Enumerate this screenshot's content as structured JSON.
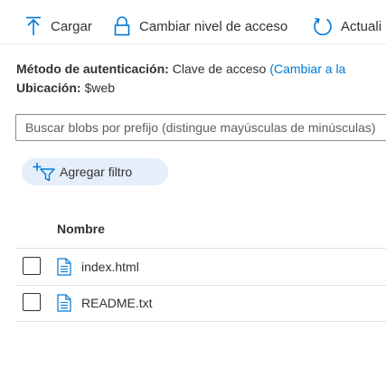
{
  "toolbar": {
    "upload_label": "Cargar",
    "change_access_label": "Cambiar nivel de acceso",
    "refresh_label": "Actuali"
  },
  "info": {
    "auth_method_label": "Método de autenticación:",
    "auth_method_value": "Clave de acceso",
    "auth_method_link": "(Cambiar a la",
    "location_label": "Ubicación:",
    "location_value": "$web"
  },
  "search": {
    "placeholder": "Buscar blobs por prefijo (distingue mayúsculas de minúsculas)"
  },
  "filter": {
    "add_filter_label": "Agregar filtro"
  },
  "table": {
    "columns": [
      "Nombre"
    ],
    "rows": [
      {
        "name": "index.html"
      },
      {
        "name": "README.txt"
      }
    ]
  },
  "colors": {
    "accent": "#0078d4",
    "pill_background": "#e5effb",
    "text": "#323130",
    "divider": "#e1dfdd"
  },
  "icons": {
    "upload": "upload-icon",
    "access": "lock-icon",
    "refresh": "refresh-icon",
    "filter": "add-filter-icon",
    "file": "document-icon"
  }
}
